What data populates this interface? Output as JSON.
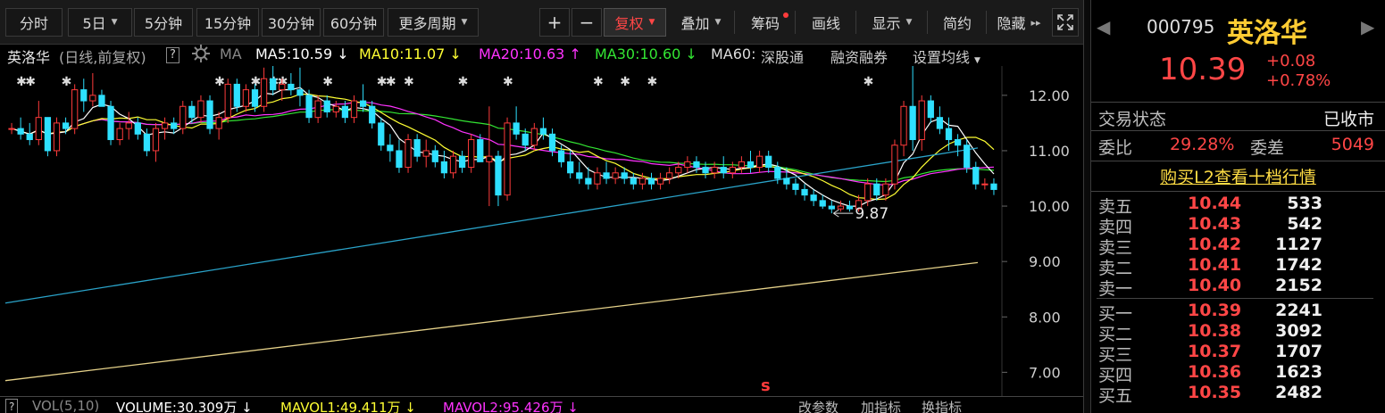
{
  "toolbar": {
    "periods": [
      "分时",
      "5日",
      "5分钟",
      "15分钟",
      "30分钟",
      "60分钟",
      "更多周期"
    ],
    "plus": "+",
    "minus": "−",
    "fuquan": "复权",
    "diejia": "叠加",
    "chouma": "筹码",
    "huaxian": "画线",
    "xianshi": "显示",
    "jianyue": "简约",
    "yincang": "隐藏"
  },
  "ma_line": {
    "name": "英洛华",
    "mode": "(日线,前复权)",
    "help": "?",
    "ma": "MA",
    "ma5": "MA5:10.59",
    "ma5_arrow": "↓",
    "ma10": "MA10:11.07",
    "ma10_arrow": "↓",
    "ma20": "MA20:10.63",
    "ma20_arrow": "↑",
    "ma30": "MA30:10.60",
    "ma30_arrow": "↓",
    "ma60": "MA60:",
    "shengutong": "深股通",
    "rongzi": "融资融券",
    "shezhi": "设置均线"
  },
  "colors": {
    "up": "#ff3b3b",
    "down": "#2ee0ff",
    "ma5": "#ffffff",
    "ma10": "#ffff33",
    "ma20": "#ff33ff",
    "ma30": "#33e633",
    "ma60": "#2aa3c9",
    "ma120": "#e6d28a"
  },
  "chart_data": {
    "type": "candlestick",
    "ylim": [
      6.7,
      12.4
    ],
    "yticks": [
      "12.00",
      "11.00",
      "10.00",
      "9.00",
      "8.00",
      "7.00"
    ],
    "annotations": {
      "high": "12.85",
      "low": "9.87"
    },
    "marker": "s",
    "candles": [
      [
        11.4,
        11.5,
        11.3,
        11.4
      ],
      [
        11.4,
        11.6,
        11.2,
        11.3
      ],
      [
        11.3,
        11.5,
        11.1,
        11.2
      ],
      [
        11.2,
        11.9,
        11.1,
        11.6
      ],
      [
        11.6,
        11.6,
        10.9,
        11.0
      ],
      [
        11.0,
        11.6,
        10.9,
        11.5
      ],
      [
        11.5,
        11.6,
        11.3,
        11.4
      ],
      [
        11.4,
        12.2,
        11.3,
        12.1
      ],
      [
        12.1,
        12.3,
        11.7,
        11.9
      ],
      [
        11.9,
        12.4,
        11.8,
        12.0
      ],
      [
        12.0,
        12.1,
        11.8,
        11.8
      ],
      [
        11.8,
        11.9,
        11.1,
        11.2
      ],
      [
        11.2,
        11.5,
        11.1,
        11.4
      ],
      [
        11.4,
        11.7,
        11.2,
        11.5
      ],
      [
        11.5,
        11.6,
        11.2,
        11.3
      ],
      [
        11.3,
        11.4,
        10.9,
        11.0
      ],
      [
        11.0,
        11.5,
        10.8,
        11.4
      ],
      [
        11.4,
        11.6,
        11.2,
        11.5
      ],
      [
        11.5,
        11.6,
        11.3,
        11.4
      ],
      [
        11.4,
        11.9,
        11.3,
        11.8
      ],
      [
        11.8,
        11.9,
        11.5,
        11.6
      ],
      [
        11.6,
        12.0,
        11.5,
        11.9
      ],
      [
        11.9,
        12.0,
        11.3,
        11.4
      ],
      [
        11.4,
        11.7,
        11.2,
        11.6
      ],
      [
        11.6,
        12.3,
        11.5,
        12.2
      ],
      [
        12.2,
        12.3,
        11.7,
        11.8
      ],
      [
        11.8,
        12.2,
        11.7,
        12.1
      ],
      [
        12.1,
        12.2,
        11.7,
        11.8
      ],
      [
        11.8,
        12.5,
        11.7,
        12.3
      ],
      [
        12.3,
        12.85,
        12.0,
        12.1
      ],
      [
        12.1,
        12.3,
        11.9,
        12.2
      ],
      [
        12.2,
        12.4,
        12.0,
        12.1
      ],
      [
        12.1,
        12.5,
        11.8,
        12.0
      ],
      [
        12.0,
        12.1,
        11.5,
        11.6
      ],
      [
        11.6,
        12.0,
        11.5,
        11.9
      ],
      [
        11.9,
        12.0,
        11.6,
        11.7
      ],
      [
        11.7,
        11.9,
        11.6,
        11.8
      ],
      [
        11.8,
        11.9,
        11.5,
        11.6
      ],
      [
        11.6,
        12.0,
        11.5,
        11.9
      ],
      [
        11.9,
        12.2,
        11.7,
        11.8
      ],
      [
        11.8,
        11.9,
        11.4,
        11.5
      ],
      [
        11.5,
        11.6,
        11.0,
        11.1
      ],
      [
        11.1,
        11.3,
        10.8,
        11.0
      ],
      [
        11.0,
        11.2,
        10.6,
        10.7
      ],
      [
        10.7,
        11.3,
        10.6,
        11.2
      ],
      [
        11.2,
        11.3,
        10.8,
        10.9
      ],
      [
        10.9,
        11.2,
        10.7,
        11.0
      ],
      [
        11.0,
        11.1,
        10.7,
        10.8
      ],
      [
        10.8,
        11.0,
        10.5,
        10.6
      ],
      [
        10.6,
        11.0,
        10.5,
        10.9
      ],
      [
        10.9,
        11.0,
        10.6,
        10.7
      ],
      [
        10.7,
        11.3,
        10.6,
        11.2
      ],
      [
        11.2,
        11.3,
        10.8,
        10.8
      ],
      [
        10.8,
        11.8,
        10.0,
        10.9
      ],
      [
        10.9,
        11.0,
        10.0,
        10.2
      ],
      [
        10.2,
        11.6,
        10.1,
        11.5
      ],
      [
        11.5,
        11.8,
        11.2,
        11.3
      ],
      [
        11.3,
        11.4,
        11.0,
        11.1
      ],
      [
        11.1,
        11.5,
        11.0,
        11.4
      ],
      [
        11.4,
        11.6,
        11.2,
        11.3
      ],
      [
        11.3,
        11.4,
        10.9,
        11.0
      ],
      [
        11.0,
        11.1,
        10.7,
        10.8
      ],
      [
        10.8,
        11.0,
        10.5,
        10.6
      ],
      [
        10.6,
        10.8,
        10.4,
        10.5
      ],
      [
        10.5,
        10.7,
        10.3,
        10.4
      ],
      [
        10.4,
        10.7,
        10.3,
        10.6
      ],
      [
        10.6,
        10.8,
        10.4,
        10.5
      ],
      [
        10.5,
        10.7,
        10.4,
        10.6
      ],
      [
        10.6,
        10.7,
        10.4,
        10.5
      ],
      [
        10.5,
        10.6,
        10.3,
        10.4
      ],
      [
        10.4,
        10.6,
        10.3,
        10.5
      ],
      [
        10.5,
        10.6,
        10.3,
        10.4
      ],
      [
        10.4,
        10.6,
        10.3,
        10.5
      ],
      [
        10.5,
        10.7,
        10.4,
        10.6
      ],
      [
        10.6,
        10.8,
        10.5,
        10.7
      ],
      [
        10.7,
        10.9,
        10.6,
        10.8
      ],
      [
        10.8,
        10.9,
        10.6,
        10.7
      ],
      [
        10.7,
        10.8,
        10.5,
        10.6
      ],
      [
        10.6,
        10.8,
        10.5,
        10.7
      ],
      [
        10.7,
        10.9,
        10.5,
        10.6
      ],
      [
        10.6,
        10.8,
        10.5,
        10.7
      ],
      [
        10.7,
        10.9,
        10.6,
        10.8
      ],
      [
        10.8,
        11.0,
        10.6,
        10.7
      ],
      [
        10.7,
        11.0,
        10.6,
        10.9
      ],
      [
        10.9,
        11.0,
        10.6,
        10.7
      ],
      [
        10.7,
        10.8,
        10.4,
        10.5
      ],
      [
        10.5,
        10.7,
        10.3,
        10.4
      ],
      [
        10.4,
        10.5,
        10.2,
        10.3
      ],
      [
        10.3,
        10.4,
        10.1,
        10.2
      ],
      [
        10.2,
        10.3,
        10.0,
        10.1
      ],
      [
        10.1,
        10.2,
        9.95,
        10.0
      ],
      [
        10.0,
        10.1,
        9.87,
        9.95
      ],
      [
        9.95,
        10.1,
        9.9,
        10.0
      ],
      [
        10.0,
        10.1,
        9.9,
        9.95
      ],
      [
        9.95,
        10.2,
        9.9,
        10.1
      ],
      [
        10.1,
        10.5,
        10.0,
        10.4
      ],
      [
        10.4,
        10.5,
        10.1,
        10.2
      ],
      [
        10.2,
        10.5,
        10.1,
        10.4
      ],
      [
        10.4,
        11.2,
        10.3,
        11.1
      ],
      [
        11.1,
        11.9,
        10.9,
        11.8
      ],
      [
        11.8,
        12.6,
        11.0,
        11.2
      ],
      [
        11.2,
        12.0,
        11.0,
        11.9
      ],
      [
        11.9,
        12.0,
        11.5,
        11.6
      ],
      [
        11.6,
        11.8,
        11.3,
        11.4
      ],
      [
        11.4,
        11.6,
        11.0,
        11.2
      ],
      [
        11.2,
        11.3,
        10.9,
        11.1
      ],
      [
        11.1,
        11.2,
        10.6,
        10.7
      ],
      [
        10.7,
        10.8,
        10.3,
        10.4
      ],
      [
        10.4,
        10.5,
        10.3,
        10.4
      ],
      [
        10.4,
        10.5,
        10.2,
        10.3
      ]
    ]
  },
  "vol_line": {
    "help": "?",
    "vol": "VOL(5,10)",
    "volume": "VOLUME:30.309万",
    "volume_arrow": "↓",
    "mavol1": "MAVOL1:49.411万",
    "mavol1_arrow": "↓",
    "mavol2": "MAVOL2:95.426万",
    "mavol2_arrow": "↓",
    "gaicanshu": "改参数",
    "jiazhibiao": "加指标",
    "huanzhibiao": "换指标"
  },
  "quote": {
    "code": "000795",
    "name": "英洛华",
    "price": "10.39",
    "change": "+0.08",
    "change_pct": "+0.78%",
    "status_label": "交易状态",
    "status_value": "已收市",
    "weibi_label": "委比",
    "weibi_value": "29.28%",
    "weicha_label": "委差",
    "weicha_value": "5049",
    "l2_link": "购买L2查看十档行情",
    "asks": [
      {
        "label": "卖五",
        "price": "10.44",
        "vol": "533"
      },
      {
        "label": "卖四",
        "price": "10.43",
        "vol": "542"
      },
      {
        "label": "卖三",
        "price": "10.42",
        "vol": "1127"
      },
      {
        "label": "卖二",
        "price": "10.41",
        "vol": "1742"
      },
      {
        "label": "卖一",
        "price": "10.40",
        "vol": "2152"
      }
    ],
    "bids": [
      {
        "label": "买一",
        "price": "10.39",
        "vol": "2241"
      },
      {
        "label": "买二",
        "price": "10.38",
        "vol": "3092"
      },
      {
        "label": "买三",
        "price": "10.37",
        "vol": "1707"
      },
      {
        "label": "买四",
        "price": "10.36",
        "vol": "1623"
      },
      {
        "label": "买五",
        "price": "10.35",
        "vol": "2482"
      }
    ]
  }
}
